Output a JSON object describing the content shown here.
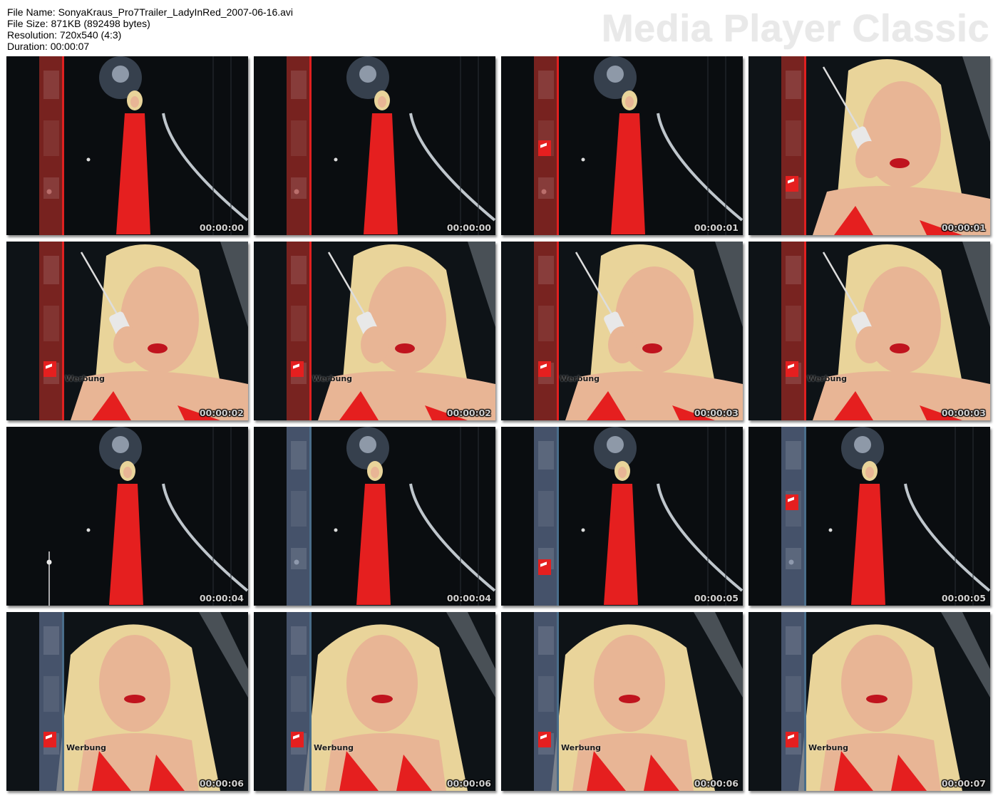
{
  "info": {
    "file_name": "File Name: SonyaKraus_Pro7Trailer_LadyInRed_2007-06-16.avi",
    "file_size": "File Size: 871KB (892498 bytes)",
    "resolution": "Resolution: 720x540 (4:3)",
    "duration": "Duration: 00:00:07"
  },
  "brand": "Media Player Classic",
  "colors": {
    "dress_red": "#e51f1f",
    "bar_red": "#9c2a24",
    "bar_blue": "#5a6a88",
    "skin": "#e8b595",
    "hair": "#e9d49a"
  },
  "thumbnails": [
    {
      "time": "00:00:00",
      "scene": "full-red",
      "bar": "red",
      "logo": false,
      "werbung": ""
    },
    {
      "time": "00:00:00",
      "scene": "full-red",
      "bar": "red",
      "logo": false,
      "werbung": ""
    },
    {
      "time": "00:00:01",
      "scene": "full-red",
      "bar": "red",
      "logo": true,
      "werbung": ""
    },
    {
      "time": "00:00:01",
      "scene": "close-phone",
      "bar": "red",
      "logo": true,
      "werbung": ""
    },
    {
      "time": "00:00:02",
      "scene": "close-phone",
      "bar": "red",
      "logo": true,
      "werbung": "Werbung"
    },
    {
      "time": "00:00:02",
      "scene": "close-phone",
      "bar": "red",
      "logo": true,
      "werbung": "Werbung"
    },
    {
      "time": "00:00:03",
      "scene": "close-phone",
      "bar": "red",
      "logo": true,
      "werbung": "Werbung"
    },
    {
      "time": "00:00:03",
      "scene": "close-phone",
      "bar": "red",
      "logo": true,
      "werbung": "Werbung"
    },
    {
      "time": "00:00:04",
      "scene": "full-walk",
      "bar": "none",
      "logo": false,
      "werbung": ""
    },
    {
      "time": "00:00:04",
      "scene": "full-walk",
      "bar": "blue",
      "logo": false,
      "werbung": ""
    },
    {
      "time": "00:00:05",
      "scene": "full-walk",
      "bar": "blue",
      "logo": true,
      "werbung": ""
    },
    {
      "time": "00:00:05",
      "scene": "full-walk",
      "bar": "blue",
      "logo": true,
      "werbung": ""
    },
    {
      "time": "00:00:06",
      "scene": "close-front",
      "bar": "blue",
      "logo": true,
      "werbung": "Werbung"
    },
    {
      "time": "00:00:06",
      "scene": "close-front",
      "bar": "blue",
      "logo": true,
      "werbung": "Werbung"
    },
    {
      "time": "00:00:06",
      "scene": "close-front",
      "bar": "blue",
      "logo": true,
      "werbung": "Werbung"
    },
    {
      "time": "00:00:07",
      "scene": "close-front",
      "bar": "blue",
      "logo": true,
      "werbung": "Werbung"
    }
  ]
}
